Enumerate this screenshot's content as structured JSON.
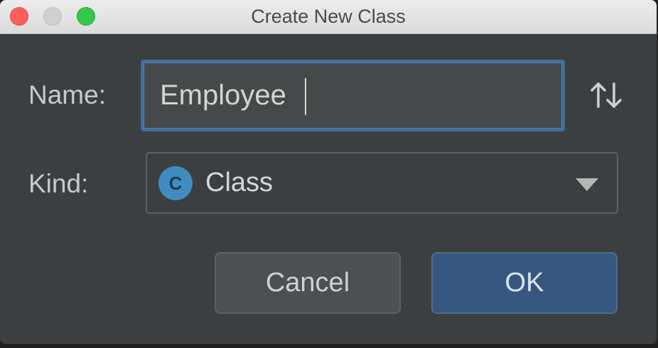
{
  "window": {
    "title": "Create New Class"
  },
  "form": {
    "name_label": "Name:",
    "name_value": "Employee",
    "kind_label": "Kind:",
    "kind_icon_letter": "C",
    "kind_value": "Class"
  },
  "buttons": {
    "cancel_label": "Cancel",
    "ok_label": "OK"
  },
  "icons": {
    "sort": "sort-arrows-icon",
    "class": "class-icon",
    "dropdown": "chevron-down-icon"
  },
  "colors": {
    "accent": "#3f6ea3",
    "ok_button": "#365880",
    "class_icon": "#3f8dc0",
    "background": "#3c3f41"
  }
}
